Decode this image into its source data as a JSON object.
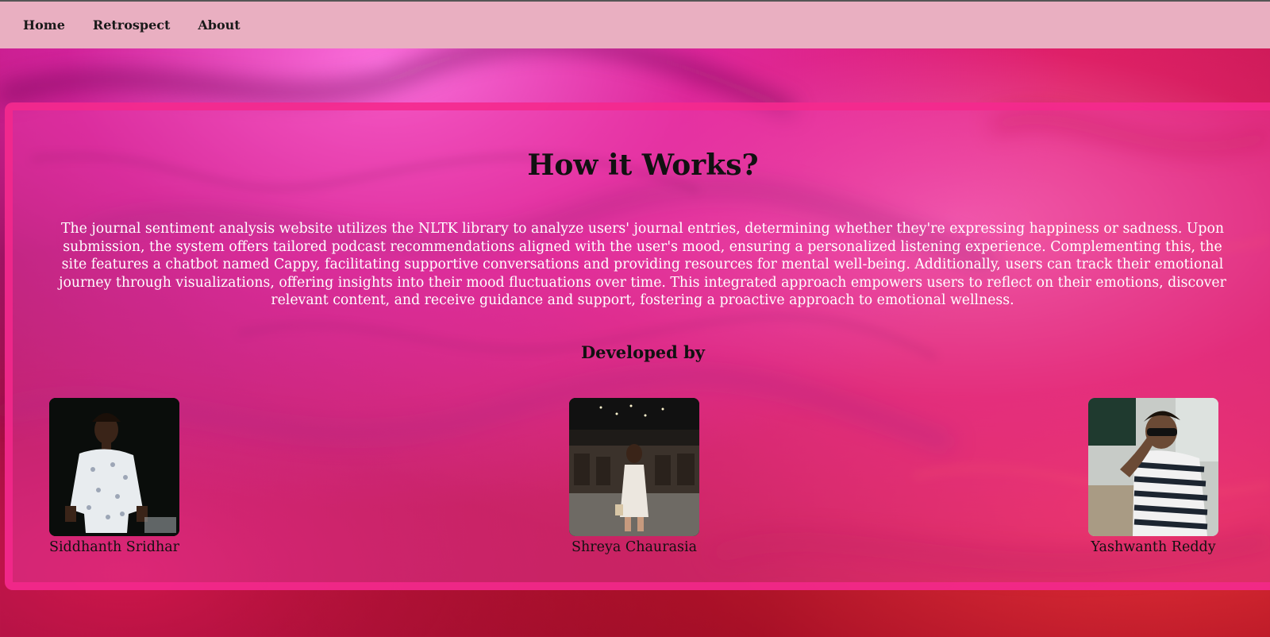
{
  "nav": {
    "items": [
      {
        "label": "Home"
      },
      {
        "label": "Retrospect"
      },
      {
        "label": "About"
      }
    ]
  },
  "main": {
    "title": "How it Works?",
    "description": "The journal sentiment analysis website utilizes the NLTK library to analyze users' journal entries, determining whether they're expressing happiness or sadness. Upon submission, the system offers tailored podcast recommendations aligned with the user's mood, ensuring a personalized listening experience. Complementing this, the site features a chatbot named Cappy, facilitating supportive conversations and providing resources for mental well-being. Additionally, users can track their emotional journey through visualizations, offering insights into their mood fluctuations over time. This integrated approach empowers users to reflect on their emotions, discover relevant content, and receive guidance and support, fostering a proactive approach to emotional wellness.",
    "developers_heading": "Developed by",
    "developers": [
      {
        "name": "Siddhanth Sridhar"
      },
      {
        "name": "Shreya Chaurasia"
      },
      {
        "name": "Yashwanth Reddy"
      }
    ]
  },
  "colors": {
    "navbar": "#e9afc1",
    "panel_border": "#f5288c",
    "text_light": "#ffffff",
    "text_dark": "#111111"
  }
}
